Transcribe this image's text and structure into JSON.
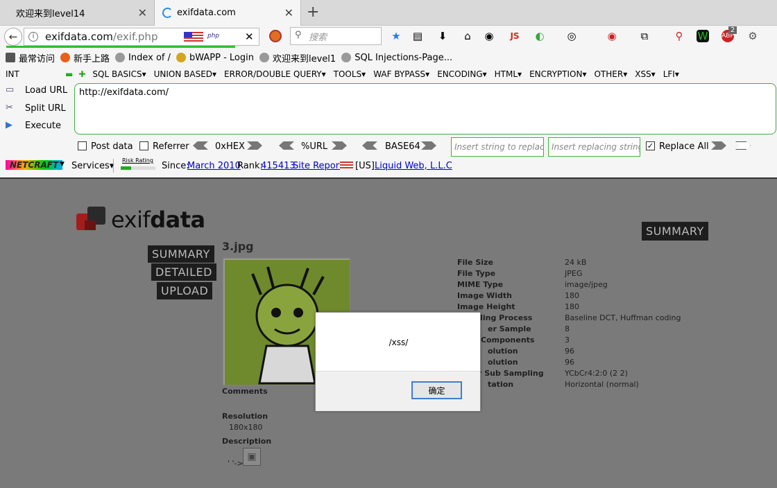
{
  "tabs": [
    {
      "title": "欢迎来到level14"
    },
    {
      "title": "exifdata.com"
    }
  ],
  "url": {
    "host": "exifdata.com",
    "path": "/exif.php",
    "badge": "php"
  },
  "search": {
    "placeholder": "搜索"
  },
  "toolbar": {
    "js_label": "JS",
    "abp_count": "2"
  },
  "bookmarks": [
    "最常访问",
    "新手上路",
    "Index of /",
    "bWAPP - Login",
    "欢迎来到level1",
    "SQL Injections-Page..."
  ],
  "hackbar": {
    "type_select": "INT",
    "menus": [
      "SQL BASICS▾",
      "UNION BASED▾",
      "ERROR/DOUBLE QUERY▾",
      "TOOLS▾",
      "WAF BYPASS▾",
      "ENCODING▾",
      "HTML▾",
      "ENCRYPTION▾",
      "OTHER▾",
      "XSS▾",
      "LFI▾"
    ],
    "load_url": "Load URL",
    "split_url": "Split URL",
    "execute": "Execute",
    "url_value": "http://exifdata.com/",
    "post_data": "Post data",
    "referrer": "Referrer",
    "hex": "0xHEX",
    "url_enc": "%URL",
    "base64": "BASE64",
    "insert_placeholder": "Insert string to replace",
    "replacing_placeholder": "Insert replacing string",
    "replace_all": "Replace All"
  },
  "netcraft": {
    "logo": "NETCRAFT",
    "services": "Services▾",
    "risk": "Risk Rating",
    "since_label": "Since:",
    "since": "March 2010",
    "rank_label": "Rank:",
    "rank": "415413",
    "report": "Site Report",
    "country": "[US]",
    "host": "Liquid Web, L.L.C"
  },
  "page": {
    "logo_a": "exif",
    "logo_b": "data",
    "nav": [
      "SUMMARY",
      "DETAILED",
      "UPLOAD"
    ],
    "summary_badge": "SUMMARY",
    "filename": "3.jpg",
    "meta_keys": [
      "File Size",
      "File Type",
      "MIME Type",
      "Image Width",
      "Image Height",
      "ding Process",
      "er Sample",
      "Components",
      "olution",
      "olution",
      "r Sub Sampling",
      "tation"
    ],
    "meta_values": [
      "24 kB",
      "JPEG",
      "image/jpeg",
      "180",
      "180",
      "Baseline DCT, Huffman coding",
      "8",
      "3",
      "96",
      "96",
      "YCbCr4:2:0 (2 2)",
      "Horizontal (normal)"
    ],
    "comments_label": "Comments",
    "resolution_label": "Resolution",
    "resolution_value": "180x180",
    "description_label": "Description",
    "description_value": "' '->"
  },
  "dialog": {
    "message": "/xss/",
    "ok": "确定"
  }
}
